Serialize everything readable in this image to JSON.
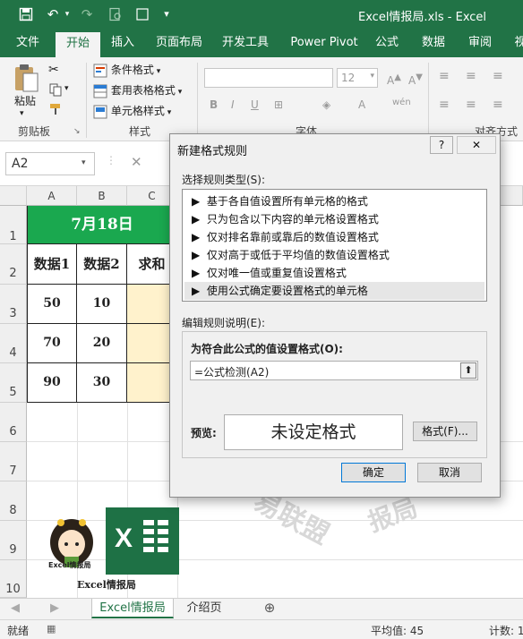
{
  "window": {
    "title": "Excel情报局.xls - Excel"
  },
  "ribbon_tabs": [
    "文件",
    "开始",
    "插入",
    "页面布局",
    "开发工具",
    "Power Pivot",
    "公式",
    "数据",
    "审阅",
    "视"
  ],
  "active_tab": "开始",
  "ribbon": {
    "clipboard": {
      "paste": "粘贴",
      "group": "剪贴板"
    },
    "styles": {
      "conditional_format": "条件格式",
      "table_format": "套用表格格式",
      "cell_styles": "单元格样式",
      "group": "样式"
    },
    "font": {
      "size": "12",
      "bold": "B",
      "italic": "I",
      "underline": "U",
      "phonetic": "wén",
      "group": "字体"
    },
    "alignment": {
      "group": "对齐方式"
    }
  },
  "formula_bar": {
    "name_box": "A2",
    "cancel": "✕"
  },
  "sheet": {
    "columns": [
      "A",
      "B",
      "C"
    ],
    "rows": [
      "1",
      "2",
      "3",
      "4",
      "5",
      "6",
      "7",
      "8",
      "9",
      "10"
    ],
    "header_date": "7月18日",
    "headers": [
      "数据1",
      "数据2",
      "求和"
    ],
    "data": [
      [
        "50",
        "10"
      ],
      [
        "70",
        "20"
      ],
      [
        "90",
        "30"
      ]
    ],
    "logo_text": "Excel情报局",
    "logo_caption": "Excel情报局",
    "excel_logo": "X",
    "watermark": [
      "易联盟",
      "报局"
    ]
  },
  "sheet_tabs": [
    "Excel情报局",
    "介绍页"
  ],
  "status": {
    "mode": "就绪",
    "average": "平均值: 45",
    "count": "计数: 1"
  },
  "dialog": {
    "title": "新建格式规则",
    "help": "?",
    "rule_type_label": "选择规则类型(S):",
    "rule_types": [
      "基于各自值设置所有单元格的格式",
      "只为包含以下内容的单元格设置格式",
      "仅对排名靠前或靠后的数值设置格式",
      "仅对高于或低于平均值的数值设置格式",
      "仅对唯一值或重复值设置格式",
      "使用公式确定要设置格式的单元格"
    ],
    "selected_rule_index": 5,
    "edit_label": "编辑规则说明(E):",
    "formula_label": "为符合此公式的值设置格式(O):",
    "formula_value": "=公式检测(A2)",
    "preview_label": "预览:",
    "preview_text": "未设定格式",
    "format_button": "格式(F)...",
    "ok": "确定",
    "cancel": "取消"
  },
  "colors": {
    "excel_green": "#217346",
    "header_green": "#1aa84f",
    "sum_cell": "#fff2cc"
  }
}
